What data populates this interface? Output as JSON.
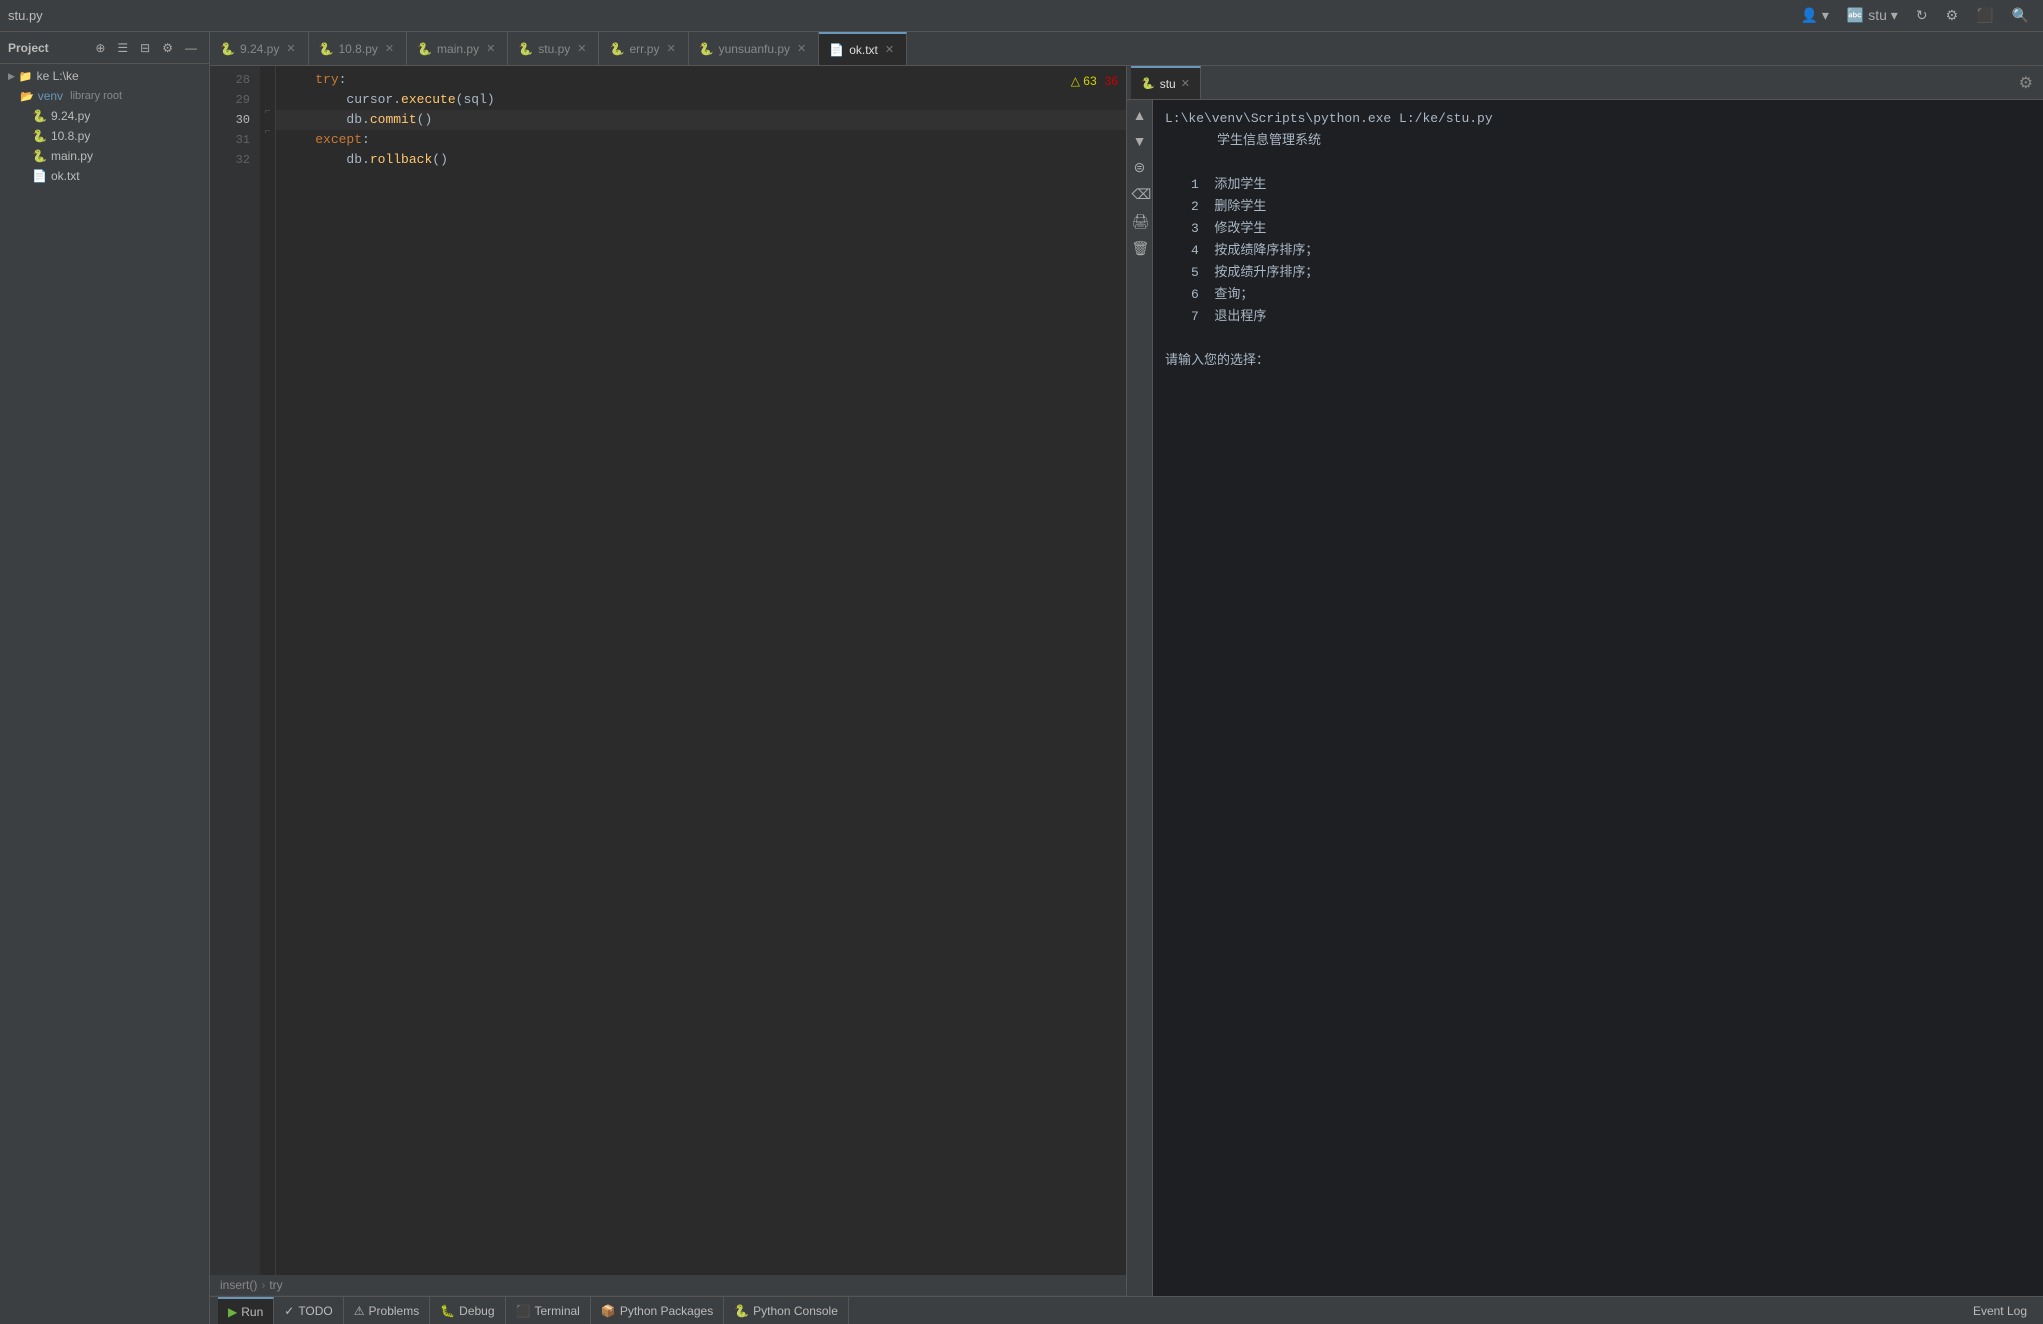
{
  "titleBar": {
    "title": "stu.py"
  },
  "toolbar": {
    "profileIcon": "👤",
    "branchLabel": "stu",
    "reloadIcon": "↻",
    "settingsIcon": "⚙",
    "stopIcon": "⬛",
    "searchIcon": "🔍"
  },
  "sidebar": {
    "title": "Project",
    "rootLabel": "ke L:\\ke",
    "items": [
      {
        "label": "venv  library root",
        "type": "folder",
        "expanded": true,
        "depth": 1
      },
      {
        "label": "9.24.py",
        "type": "py",
        "depth": 2
      },
      {
        "label": "10.8.py",
        "type": "py",
        "depth": 2
      },
      {
        "label": "main.py",
        "type": "py",
        "depth": 2
      },
      {
        "label": "ok.txt",
        "type": "txt",
        "depth": 2
      }
    ]
  },
  "tabs": [
    {
      "label": "9.24.py",
      "type": "py",
      "active": false
    },
    {
      "label": "10.8.py",
      "type": "py",
      "active": false
    },
    {
      "label": "main.py",
      "type": "py",
      "active": false
    },
    {
      "label": "stu.py",
      "type": "py",
      "active": false
    },
    {
      "label": "err.py",
      "type": "py",
      "active": false
    },
    {
      "label": "yunsuanfu.py",
      "type": "py",
      "active": false
    },
    {
      "label": "ok.txt",
      "type": "txt",
      "active": true
    }
  ],
  "warnings": {
    "warningCount": "△ 63",
    "errorCount": "36"
  },
  "codeLines": [
    {
      "num": 28,
      "content": "    try:",
      "active": false
    },
    {
      "num": 29,
      "content": "        cursor.execute(sql)",
      "active": false
    },
    {
      "num": 30,
      "content": "        db.commit()",
      "active": true
    },
    {
      "num": 31,
      "content": "    except:",
      "active": false
    },
    {
      "num": 32,
      "content": "        db.rollback()",
      "active": false
    }
  ],
  "breadcrumb": {
    "parts": [
      "insert()",
      "try"
    ]
  },
  "runPanel": {
    "tabs": [
      {
        "label": "stu",
        "active": true
      }
    ],
    "command": "L:\\ke\\venv\\Scripts\\python.exe L:/ke/stu.py",
    "output": [
      {
        "text": "学生信息管理系统"
      },
      {
        "text": ""
      },
      {
        "text": "  1  添加学生"
      },
      {
        "text": "  2  删除学生"
      },
      {
        "text": "  3  修改学生"
      },
      {
        "text": "  4  按成绩降序排序；"
      },
      {
        "text": "  5  按成绩升序排序；"
      },
      {
        "text": "  6  查询；"
      },
      {
        "text": "  7  退出程序"
      },
      {
        "text": ""
      },
      {
        "text": "请输入您的选择："
      }
    ]
  },
  "statusBar": {
    "runLabel": "Run",
    "todoLabel": "TODO",
    "problemsLabel": "Problems",
    "debugLabel": "Debug",
    "terminalLabel": "Terminal",
    "pythonPackagesLabel": "Python Packages",
    "pythonConsoleLabel": "Python Console",
    "eventLogLabel": "Event Log"
  }
}
